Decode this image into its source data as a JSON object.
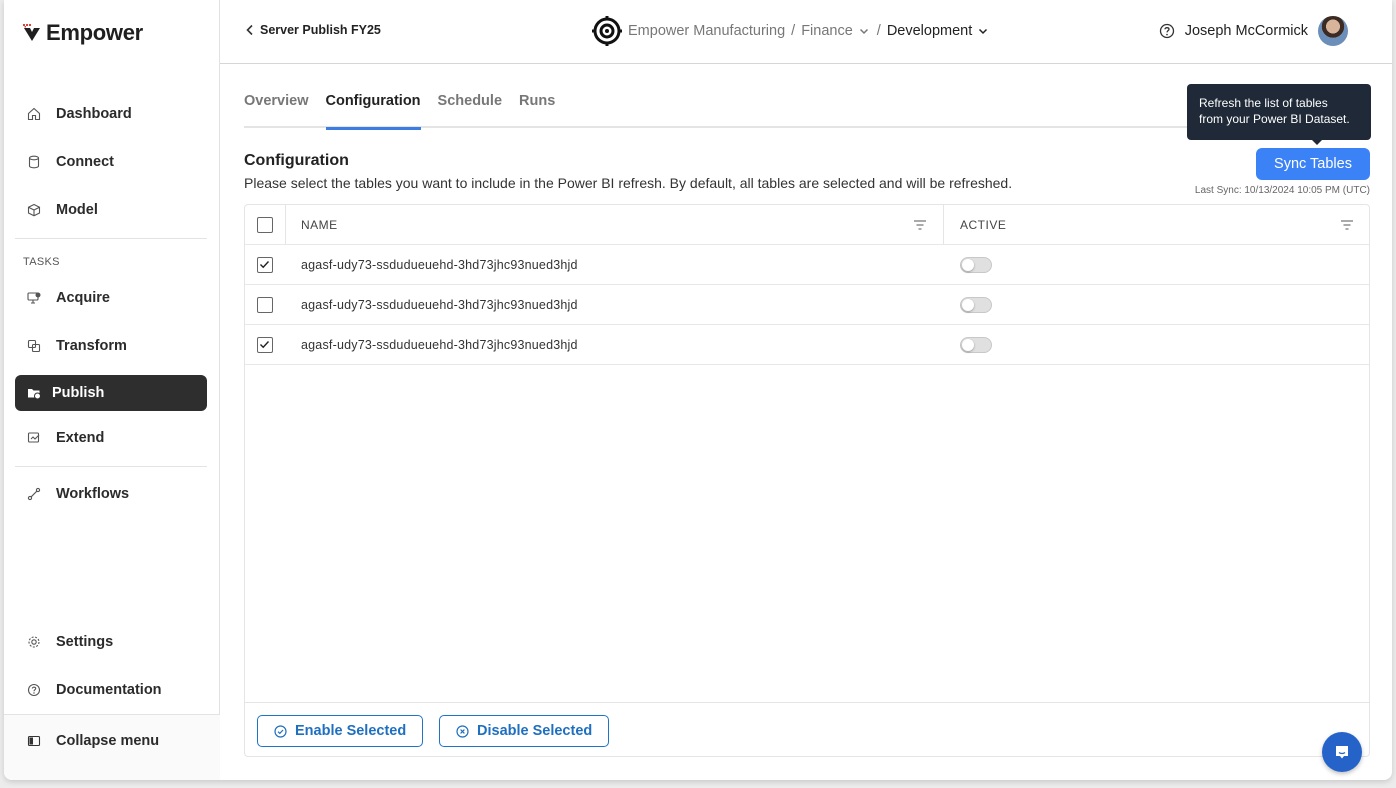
{
  "brand": {
    "name": "Empower"
  },
  "sidebar": {
    "items": [
      {
        "label": "Dashboard",
        "icon": "home-icon"
      },
      {
        "label": "Connect",
        "icon": "database-icon"
      },
      {
        "label": "Model",
        "icon": "cube-icon"
      }
    ],
    "tasks_label": "TASKS",
    "tasks": [
      {
        "label": "Acquire",
        "icon": "monitor-download-icon"
      },
      {
        "label": "Transform",
        "icon": "transform-icon"
      },
      {
        "label": "Publish",
        "icon": "folder-upload-icon",
        "active": true
      },
      {
        "label": "Extend",
        "icon": "extend-icon"
      }
    ],
    "workflows": {
      "label": "Workflows",
      "icon": "workflow-icon"
    },
    "bottom": [
      {
        "label": "Settings",
        "icon": "gear-icon"
      },
      {
        "label": "Documentation",
        "icon": "help-circle-icon"
      }
    ],
    "collapse": {
      "label": "Collapse menu",
      "icon": "sidebar-collapse-icon"
    }
  },
  "header": {
    "back_label": "Server Publish FY25",
    "breadcrumb": {
      "org": "Empower Manufacturing",
      "separator": "/",
      "dept": "Finance",
      "env": "Development"
    },
    "user": {
      "name": "Joseph McCormick"
    }
  },
  "tabs": [
    {
      "label": "Overview"
    },
    {
      "label": "Configuration",
      "active": true
    },
    {
      "label": "Schedule"
    },
    {
      "label": "Runs"
    }
  ],
  "tooltip": {
    "line1": "Refresh the list of tables",
    "line2": "from your Power BI Dataset."
  },
  "configuration": {
    "title": "Configuration",
    "description": "Please select the tables you want to include in the Power BI refresh. By default, all tables are selected and will be refreshed.",
    "sync_button": "Sync Tables",
    "last_sync": "Last Sync: 10/13/2024 10:05 PM (UTC)"
  },
  "table": {
    "columns": [
      "NAME",
      "ACTIVE"
    ],
    "rows": [
      {
        "name": "agasf-udy73-ssdudueuehd-3hd73jhc93nued3hjd",
        "checked": true,
        "active": false
      },
      {
        "name": "agasf-udy73-ssdudueuehd-3hd73jhc93nued3hjd",
        "checked": false,
        "active": false
      },
      {
        "name": "agasf-udy73-ssdudueuehd-3hd73jhc93nued3hjd",
        "checked": true,
        "active": false
      }
    ]
  },
  "actions": {
    "enable": "Enable Selected",
    "disable": "Disable Selected"
  },
  "colors": {
    "accent": "#3b82f6",
    "active_nav": "#2e2e2e",
    "tooltip_bg": "#1f2937",
    "action_blue": "#1f6fc0"
  }
}
